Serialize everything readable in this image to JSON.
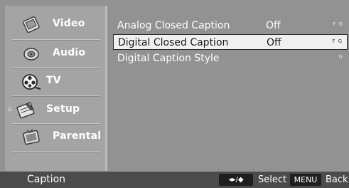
{
  "sidebar": {
    "items": [
      {
        "label": "Video",
        "icon": "video-icon"
      },
      {
        "label": "Audio",
        "icon": "audio-icon"
      },
      {
        "label": "TV",
        "icon": "tv-reel-icon"
      },
      {
        "label": "Setup",
        "icon": "setup-icon",
        "prefix": "G"
      },
      {
        "label": "Parental",
        "icon": "parental-icon"
      }
    ]
  },
  "content": {
    "rows": [
      {
        "label": "Analog Closed Caption",
        "value": "Off",
        "code": "F G"
      },
      {
        "label": "Digital Closed Caption",
        "value": "Off",
        "code": "F G",
        "selected": true
      },
      {
        "label": "Digital Caption Style",
        "value": "",
        "code": "G"
      }
    ]
  },
  "footer": {
    "title": "Caption",
    "nav_key": "◂▸/◆",
    "select_label": "Select",
    "menu_key": "MENU",
    "back_label": "Back"
  },
  "colors": {
    "background": "#929292",
    "sidebar": "#a4a4a4",
    "footer": "#4b4b4b",
    "selected_row": "#f0f0f0"
  }
}
